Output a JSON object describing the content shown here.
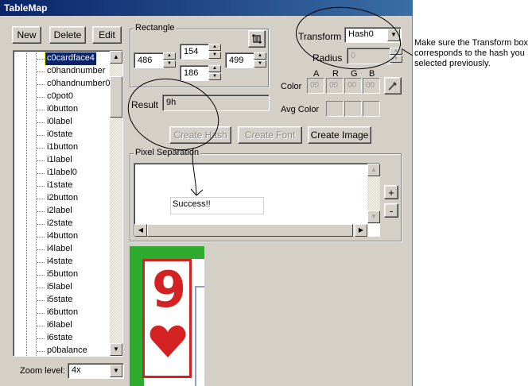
{
  "window": {
    "title": "TableMap"
  },
  "toolbar": {
    "new_label": "New",
    "delete_label": "Delete",
    "edit_label": "Edit"
  },
  "tree": {
    "items": [
      "c0cardface4",
      "c0handnumber",
      "c0handnumber0",
      "c0pot0",
      "i0button",
      "i0label",
      "i0state",
      "i1button",
      "i1label",
      "i1label0",
      "i1state",
      "i2button",
      "i2label",
      "i2state",
      "i4button",
      "i4label",
      "i4state",
      "i5button",
      "i5label",
      "i5state",
      "i6button",
      "i6label",
      "i6state",
      "p0balance"
    ],
    "selected_index": 0
  },
  "zoom": {
    "label": "Zoom level:",
    "value": "4x"
  },
  "rectangle": {
    "title": "Rectangle",
    "left": "486",
    "top": "154",
    "bottom": "186",
    "right": "499"
  },
  "transform": {
    "label": "Transform",
    "value": "Hash0"
  },
  "radius": {
    "label": "Radius",
    "value": "0"
  },
  "color": {
    "label": "Color",
    "headers": [
      "A",
      "R",
      "G",
      "B"
    ],
    "values": [
      "00",
      "00",
      "00",
      "00"
    ]
  },
  "avg_color": {
    "label": "Avg Color"
  },
  "result": {
    "label": "Result",
    "value": "9h"
  },
  "actions": {
    "create_hash": "Create Hash",
    "create_font": "Create Font",
    "create_image": "Create Image"
  },
  "pixel_sep": {
    "title": "Pixel Separation",
    "overlay_text": "Success!!"
  },
  "side_buttons": {
    "plus": "+",
    "minus": "-"
  },
  "annotation": {
    "line1": "Make sure the Transform box",
    "line2": "corresponds to the hash you",
    "line3": "selected previously."
  },
  "card": {
    "rank": "9"
  },
  "colors": {
    "titlebar": "#0a246a",
    "card_red": "#d42222",
    "card_green": "#2eab2e",
    "selection": "#0a246a"
  }
}
